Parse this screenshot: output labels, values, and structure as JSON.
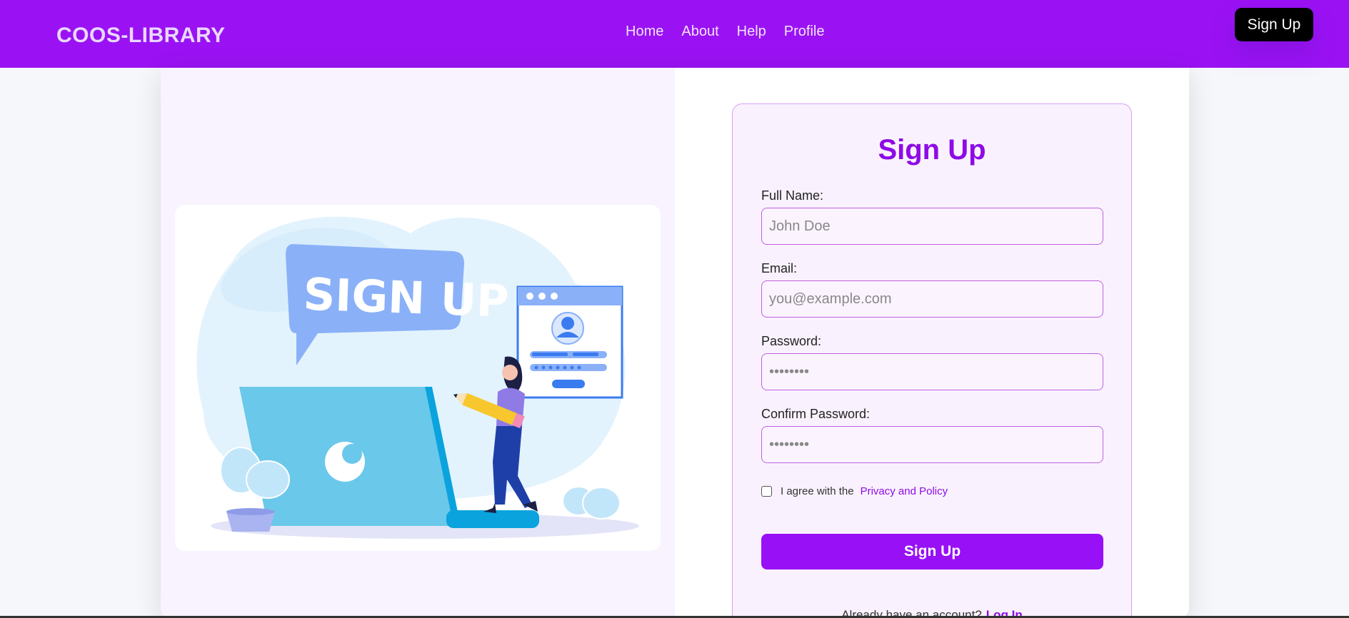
{
  "navbar": {
    "brand": "COOS-LIBRARY",
    "links": [
      "Home",
      "About",
      "Help",
      "Profile"
    ],
    "signup_button": "Sign Up"
  },
  "illustration": {
    "bubble_text": "SIGN UP"
  },
  "form": {
    "title": "Sign Up",
    "fields": [
      {
        "label": "Full Name:",
        "placeholder": "John Doe",
        "type": "text"
      },
      {
        "label": "Email:",
        "placeholder": "you@example.com",
        "type": "email"
      },
      {
        "label": "Password:",
        "placeholder": "••••••••",
        "type": "password"
      },
      {
        "label": "Confirm Password:",
        "placeholder": "••••••••",
        "type": "password"
      }
    ],
    "agree_text": "I agree with the",
    "privacy_link": "Privacy and Policy",
    "submit_label": "Sign Up",
    "login_prompt": "Already have an account?",
    "login_link": "Log In"
  },
  "colors": {
    "primary": "#9a12f3",
    "accent": "#8e0ae6",
    "button": "#9810f5"
  }
}
